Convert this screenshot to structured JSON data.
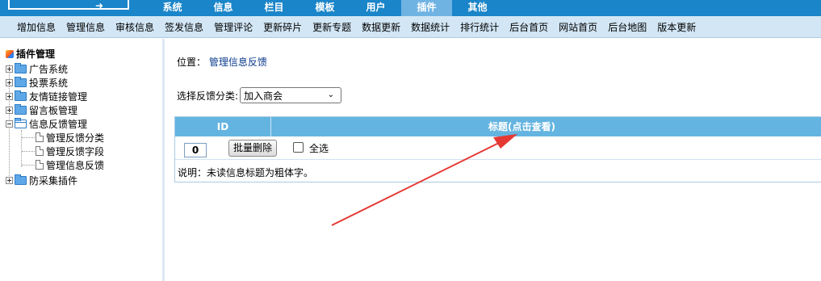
{
  "top_nav": {
    "tabs": [
      {
        "label": "系统"
      },
      {
        "label": "信息"
      },
      {
        "label": "栏目"
      },
      {
        "label": "模板"
      },
      {
        "label": "用户"
      },
      {
        "label": "插件"
      },
      {
        "label": "其他"
      }
    ],
    "active_tab": "插件"
  },
  "sub_nav": {
    "items": [
      "增加信息",
      "管理信息",
      "审核信息",
      "签发信息",
      "管理评论",
      "更新碎片",
      "更新专题",
      "数据更新",
      "数据统计",
      "排行统计",
      "后台首页",
      "网站首页",
      "后台地图",
      "版本更新"
    ]
  },
  "sidebar": {
    "root_label": "插件管理",
    "nodes": [
      {
        "label": "广告系统"
      },
      {
        "label": "投票系统"
      },
      {
        "label": "友情链接管理"
      },
      {
        "label": "留言板管理"
      },
      {
        "label": "信息反馈管理"
      }
    ],
    "children": [
      {
        "label": "管理反馈分类"
      },
      {
        "label": "管理反馈字段"
      },
      {
        "label": "管理信息反馈"
      }
    ],
    "last_node": {
      "label": "防采集插件"
    }
  },
  "main": {
    "location_prefix": "位置：",
    "location_link": "管理信息反馈",
    "filter_label": "选择反馈分类:",
    "filter_value": "加入商会",
    "table": {
      "col_id": "ID",
      "col_title": "标题(点击查看)",
      "id_value": "0",
      "bulk_delete": "批量删除",
      "select_all": "全选"
    },
    "note": "说明：未读信息标题为粗体字。"
  },
  "colors": {
    "top_bar": "#1a85c9",
    "sub_bar": "#d2e6f5",
    "table_header": "#63b4e0",
    "annotation_arrow": "#e53935"
  }
}
